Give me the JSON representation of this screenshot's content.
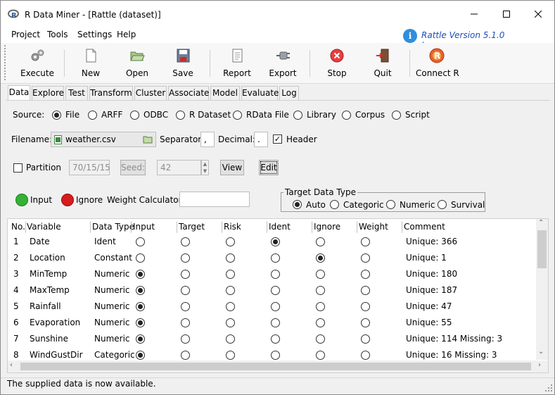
{
  "window": {
    "title": "R Data Miner - [Rattle (dataset)]"
  },
  "menu": [
    "Project",
    "Tools",
    "Settings",
    "Help"
  ],
  "version": {
    "text": "Rattle Version 5.1.0",
    "link": "togaware.com"
  },
  "toolbar": [
    "Execute",
    "New",
    "Open",
    "Save",
    "Report",
    "Export",
    "Stop",
    "Quit",
    "Connect R"
  ],
  "tabs": [
    "Data",
    "Explore",
    "Test",
    "Transform",
    "Cluster",
    "Associate",
    "Model",
    "Evaluate",
    "Log"
  ],
  "source": {
    "label": "Source:",
    "options": [
      "File",
      "ARFF",
      "ODBC",
      "R Dataset",
      "RData File",
      "Library",
      "Corpus",
      "Script"
    ],
    "selected": "File"
  },
  "file": {
    "filename_label": "Filename:",
    "filename": "weather.csv",
    "separator_label": "Separator:",
    "separator": ",",
    "decimal_label": "Decimal:",
    "decimal": ".",
    "header_label": "Header",
    "header_checked": true
  },
  "partition": {
    "label": "Partition",
    "checked": false,
    "value": "70/15/15",
    "seed_label": "Seed:",
    "seed": "42",
    "view_label": "View",
    "edit_label": "Edit"
  },
  "roles": {
    "input_label": "Input",
    "ignore_label": "Ignore",
    "weight_label": "Weight Calculator:",
    "weight_value": ""
  },
  "target_type": {
    "legend": "Target Data Type",
    "options": [
      "Auto",
      "Categoric",
      "Numeric",
      "Survival"
    ],
    "selected": "Auto"
  },
  "table": {
    "headers": [
      "No.",
      "Variable",
      "Data Type",
      "Input",
      "Target",
      "Risk",
      "Ident",
      "Ignore",
      "Weight",
      "Comment"
    ],
    "rows": [
      {
        "no": "1",
        "variable": "Date",
        "type": "Ident",
        "role": "Ident",
        "comment": "Unique: 366"
      },
      {
        "no": "2",
        "variable": "Location",
        "type": "Constant",
        "role": "Ignore",
        "comment": "Unique: 1"
      },
      {
        "no": "3",
        "variable": "MinTemp",
        "type": "Numeric",
        "role": "Input",
        "comment": "Unique: 180"
      },
      {
        "no": "4",
        "variable": "MaxTemp",
        "type": "Numeric",
        "role": "Input",
        "comment": "Unique: 187"
      },
      {
        "no": "5",
        "variable": "Rainfall",
        "type": "Numeric",
        "role": "Input",
        "comment": "Unique: 47"
      },
      {
        "no": "6",
        "variable": "Evaporation",
        "type": "Numeric",
        "role": "Input",
        "comment": "Unique: 55"
      },
      {
        "no": "7",
        "variable": "Sunshine",
        "type": "Numeric",
        "role": "Input",
        "comment": "Unique: 114 Missing: 3"
      },
      {
        "no": "8",
        "variable": "WindGustDir",
        "type": "Categoric",
        "role": "Input",
        "comment": "Unique: 16 Missing: 3"
      }
    ]
  },
  "status": "The supplied data is now available.",
  "colors": {
    "input_dot": "#33b233",
    "ignore_dot": "#d81b1b",
    "version_text": "#1f4fb8"
  }
}
